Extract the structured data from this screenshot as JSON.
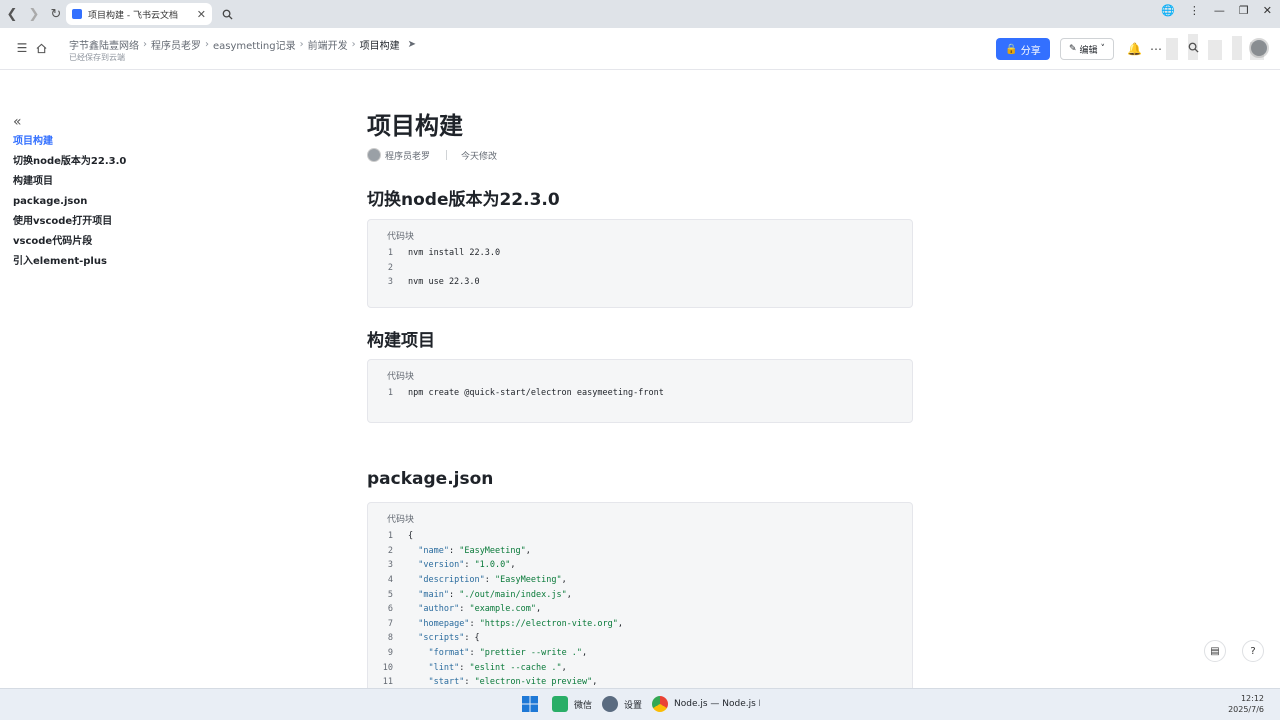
{
  "browser": {
    "tab_title": "项目构建 - 飞书云文档"
  },
  "header": {
    "breadcrumb": [
      "字节鑫陆壹网络",
      "程序员老罗",
      "easymetting记录",
      "前端开发",
      "项目构建"
    ],
    "save_status": "已经保存到云端",
    "share_label": "分享",
    "edit_label": "编辑"
  },
  "outline": {
    "items": [
      "项目构建",
      "切换node版本为22.3.0",
      "构建项目",
      "package.json",
      "使用vscode打开项目",
      "vscode代码片段",
      "引入element-plus"
    ],
    "active_index": 0
  },
  "doc": {
    "title": "项目构建",
    "author": "程序员老罗",
    "modified": "今天修改",
    "sections": [
      {
        "heading": "切换node版本为22.3.0",
        "code_label": "代码块",
        "lines": [
          {
            "n": "1",
            "t": "nvm install 22.3.0"
          },
          {
            "n": "2",
            "t": ""
          },
          {
            "n": "3",
            "t": "nvm use 22.3.0"
          }
        ]
      },
      {
        "heading": "构建项目",
        "code_label": "代码块",
        "lines": [
          {
            "n": "1",
            "t": "npm create @quick-start/electron easymeeting-front"
          }
        ]
      },
      {
        "heading": "package.json",
        "code_label": "代码块",
        "lines": [
          {
            "n": "1",
            "t": "{"
          },
          {
            "n": "2",
            "t": "  \"name\": \"EasyMeeting\","
          },
          {
            "n": "3",
            "t": "  \"version\": \"1.0.0\","
          },
          {
            "n": "4",
            "t": "  \"description\": \"EasyMeeting\","
          },
          {
            "n": "5",
            "t": "  \"main\": \"./out/main/index.js\","
          },
          {
            "n": "6",
            "t": "  \"author\": \"example.com\","
          },
          {
            "n": "7",
            "t": "  \"homepage\": \"https://electron-vite.org\","
          },
          {
            "n": "8",
            "t": "  \"scripts\": {"
          },
          {
            "n": "9",
            "t": "    \"format\": \"prettier --write .\","
          },
          {
            "n": "10",
            "t": "    \"lint\": \"eslint --cache .\","
          },
          {
            "n": "11",
            "t": "    \"start\": \"electron-vite preview\","
          }
        ]
      }
    ]
  },
  "taskbar": {
    "wechat": "微信",
    "settings": "设置",
    "chrome": "Node.js — Node.js Relea",
    "time": "12:12",
    "date": "2025/7/6"
  }
}
